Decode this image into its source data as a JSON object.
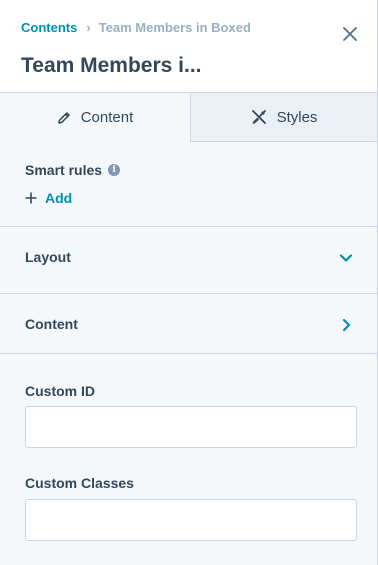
{
  "breadcrumb": {
    "parent": "Contents",
    "separator": "›",
    "current": "Team Members in Boxed"
  },
  "header": {
    "title": "Team Members i..."
  },
  "tabs": [
    {
      "label": "Content",
      "icon": "pencil-icon",
      "active": true
    },
    {
      "label": "Styles",
      "icon": "brush-icon",
      "active": false
    }
  ],
  "smart_rules": {
    "label": "Smart rules",
    "info_icon": "i",
    "add_label": "Add"
  },
  "sections": [
    {
      "label": "Layout",
      "state": "expanded",
      "icon": "chevron-down-icon"
    },
    {
      "label": "Content",
      "state": "collapsed",
      "icon": "chevron-right-icon"
    }
  ],
  "fields": {
    "custom_id": {
      "label": "Custom ID",
      "value": ""
    },
    "custom_classes": {
      "label": "Custom Classes",
      "value": ""
    }
  },
  "colors": {
    "accent": "#0091ae",
    "text": "#33475b",
    "muted": "#99afc4",
    "border": "#cbd6e2",
    "panel_bg": "#f5f8fa",
    "inactive_tab_bg": "#eaf0f6"
  }
}
